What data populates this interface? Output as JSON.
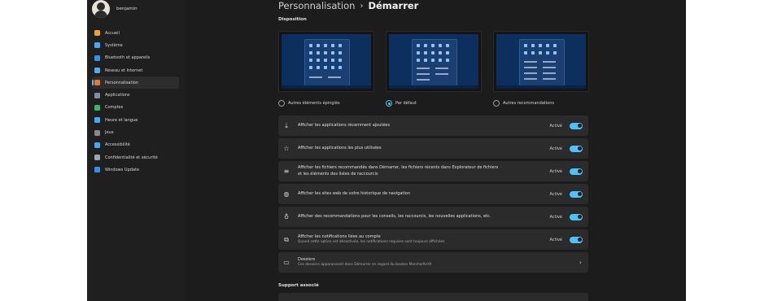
{
  "user": {
    "name": "benjamin"
  },
  "sidebar": {
    "items": [
      {
        "label": "Accueil",
        "icon": "home-icon",
        "color": "#e8a33c"
      },
      {
        "label": "Système",
        "icon": "system-icon",
        "color": "#4aa8ef"
      },
      {
        "label": "Bluetooth et appareils",
        "icon": "bluetooth-icon",
        "color": "#3b8fe0"
      },
      {
        "label": "Réseau et Internet",
        "icon": "network-icon",
        "color": "#5aa8e8"
      },
      {
        "label": "Personnalisation",
        "icon": "brush-icon",
        "color": "#e07b3b",
        "active": true
      },
      {
        "label": "Applications",
        "icon": "apps-icon",
        "color": "#7d8ea5"
      },
      {
        "label": "Comptes",
        "icon": "accounts-icon",
        "color": "#45b06b"
      },
      {
        "label": "Heure et langue",
        "icon": "clock-icon",
        "color": "#4aa8ef"
      },
      {
        "label": "Jeux",
        "icon": "gamepad-icon",
        "color": "#8a8a8a"
      },
      {
        "label": "Accessibilité",
        "icon": "accessibility-icon",
        "color": "#4aa8ef"
      },
      {
        "label": "Confidentialité et sécurité",
        "icon": "shield-icon",
        "color": "#9aa5b1"
      },
      {
        "label": "Windows Update",
        "icon": "update-icon",
        "color": "#3b8fe0"
      }
    ]
  },
  "breadcrumb": {
    "parent": "Personnalisation",
    "separator": "›",
    "current": "Démarrer"
  },
  "layout": {
    "title": "Disposition",
    "options": [
      {
        "label": "Autres éléments épinglés",
        "checked": false
      },
      {
        "label": "Par défaut",
        "checked": true
      },
      {
        "label": "Autres recommandations",
        "checked": false
      }
    ]
  },
  "settings": [
    {
      "icon": "download-icon",
      "label": "Afficher les applications récemment ajoutées",
      "state": "Activé"
    },
    {
      "icon": "star-icon",
      "label": "Afficher les applications les plus utilisées",
      "state": "Activé"
    },
    {
      "icon": "list-icon",
      "label": "Afficher les fichiers recommandés dans Démarrer, les fichiers récents dans Explorateur de fichiers et les éléments des listes de raccourcis",
      "state": "Activé"
    },
    {
      "icon": "globe-icon",
      "label": "Afficher les sites web de votre historique de navigation",
      "state": "Activé"
    },
    {
      "icon": "lightbulb-icon",
      "label": "Afficher des recommandations pour les conseils, les raccourcis, les nouvelles applications, etc.",
      "state": "Activé"
    },
    {
      "icon": "notification-icon",
      "label": "Afficher les notifications liées au compte",
      "sub": "Quand cette option est désactivée, les notifications requises sont toujours affichées",
      "state": "Activé"
    },
    {
      "icon": "folder-icon",
      "label": "Dossiers",
      "sub": "Ces dossiers apparaissent dans Démarrer en regard du bouton Marche/Arrêt"
    }
  ],
  "support": {
    "title": "Support associé"
  }
}
